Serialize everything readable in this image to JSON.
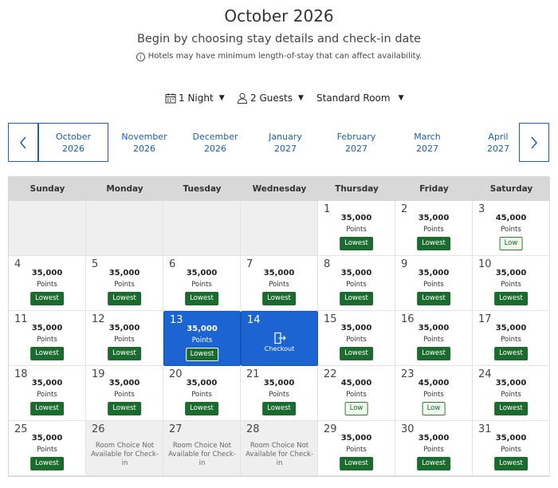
{
  "header": {
    "title": "October 2026",
    "subtitle": "Begin by choosing stay details and check-in date",
    "notice": "Hotels may have minimum length-of-stay that can affect availability."
  },
  "options": {
    "nights": "1 Night",
    "guests": "2 Guests",
    "room": "Standard Room"
  },
  "months": [
    {
      "name": "October",
      "year": "2026",
      "selected": true
    },
    {
      "name": "November",
      "year": "2026"
    },
    {
      "name": "December",
      "year": "2026"
    },
    {
      "name": "January",
      "year": "2027"
    },
    {
      "name": "February",
      "year": "2027"
    },
    {
      "name": "March",
      "year": "2027"
    },
    {
      "name": "April",
      "year": "2027"
    }
  ],
  "weekdays": [
    "Sunday",
    "Monday",
    "Tuesday",
    "Wednesday",
    "Thursday",
    "Friday",
    "Saturday"
  ],
  "points_label": "Points",
  "checkout_label": "Checkout",
  "unavailable_text": "Room Choice Not Available for Check-in",
  "first_weekday_index": 4,
  "days": [
    {
      "day": "1",
      "points": "35,000",
      "badge": "Lowest"
    },
    {
      "day": "2",
      "points": "35,000",
      "badge": "Lowest"
    },
    {
      "day": "3",
      "points": "45,000",
      "badge": "Low"
    },
    {
      "day": "4",
      "points": "35,000",
      "badge": "Lowest"
    },
    {
      "day": "5",
      "points": "35,000",
      "badge": "Lowest"
    },
    {
      "day": "6",
      "points": "35,000",
      "badge": "Lowest"
    },
    {
      "day": "7",
      "points": "35,000",
      "badge": "Lowest"
    },
    {
      "day": "8",
      "points": "35,000",
      "badge": "Lowest"
    },
    {
      "day": "9",
      "points": "35,000",
      "badge": "Lowest"
    },
    {
      "day": "10",
      "points": "35,000",
      "badge": "Lowest"
    },
    {
      "day": "11",
      "points": "35,000",
      "badge": "Lowest"
    },
    {
      "day": "12",
      "points": "35,000",
      "badge": "Lowest"
    },
    {
      "day": "13",
      "points": "35,000",
      "badge": "Lowest",
      "state": "selected"
    },
    {
      "day": "14",
      "state": "checkout"
    },
    {
      "day": "15",
      "points": "35,000",
      "badge": "Lowest"
    },
    {
      "day": "16",
      "points": "35,000",
      "badge": "Lowest"
    },
    {
      "day": "17",
      "points": "35,000",
      "badge": "Lowest"
    },
    {
      "day": "18",
      "points": "35,000",
      "badge": "Lowest"
    },
    {
      "day": "19",
      "points": "35,000",
      "badge": "Lowest"
    },
    {
      "day": "20",
      "points": "35,000",
      "badge": "Lowest"
    },
    {
      "day": "21",
      "points": "35,000",
      "badge": "Lowest"
    },
    {
      "day": "22",
      "points": "45,000",
      "badge": "Low"
    },
    {
      "day": "23",
      "points": "45,000",
      "badge": "Low"
    },
    {
      "day": "24",
      "points": "35,000",
      "badge": "Lowest"
    },
    {
      "day": "25",
      "points": "35,000",
      "badge": "Lowest"
    },
    {
      "day": "26",
      "state": "unavailable"
    },
    {
      "day": "27",
      "state": "unavailable"
    },
    {
      "day": "28",
      "state": "unavailable"
    },
    {
      "day": "29",
      "points": "35,000",
      "badge": "Lowest"
    },
    {
      "day": "30",
      "points": "35,000",
      "badge": "Lowest"
    },
    {
      "day": "31",
      "points": "35,000",
      "badge": "Lowest"
    }
  ],
  "colors": {
    "accent": "#1a5fb4",
    "selected": "#1c64d1",
    "lowest_badge": "#1b6b2e",
    "low_badge_bg": "#eef8ee",
    "unavailable_bg": "#efefef",
    "header_bg": "#d8d8d8"
  }
}
